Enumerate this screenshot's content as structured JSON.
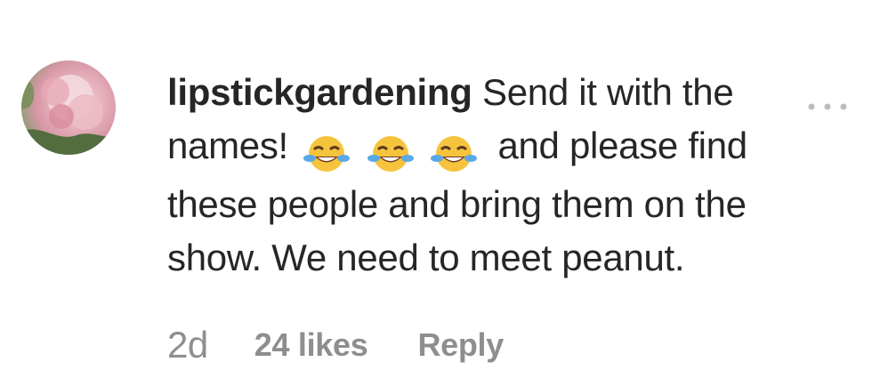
{
  "comment": {
    "username": "lipstickgardening",
    "text_before_emoji": "Send it with the names!",
    "text_after_emoji": "and please find these people and bring them on the show. We need to meet peanut.",
    "emoji": [
      "face-with-tears-of-joy",
      "face-with-tears-of-joy",
      "face-with-tears-of-joy"
    ],
    "more_label": "...",
    "time": "2d",
    "likes": "24 likes",
    "reply": "Reply"
  },
  "icons": {
    "avatar": "avatar-photo",
    "more": "more-options-icon"
  },
  "colors": {
    "text": "#262626",
    "secondary": "#8e8e8e",
    "emoji_yellow": "#f6c33d",
    "tear_blue": "#5aa9e6"
  }
}
